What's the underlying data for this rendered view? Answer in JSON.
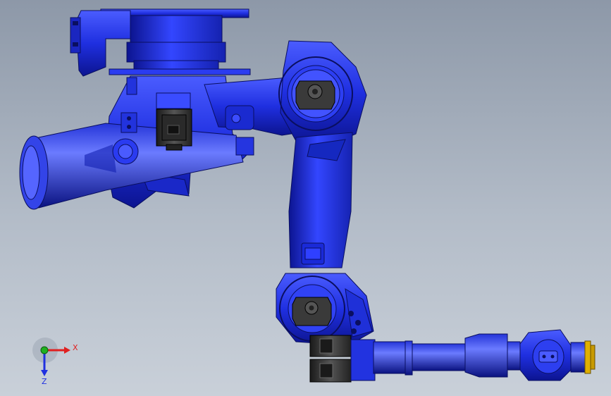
{
  "viewport": {
    "background_top": "#8d98a8",
    "background_bottom": "#c9d0d9"
  },
  "model": {
    "body_color": "#1f2fe0",
    "body_light": "#5566ff",
    "body_dark": "#0c1490",
    "motor_color": "#3a3a3a",
    "flange_color": "#e0b000"
  },
  "triad": {
    "x_label": "X",
    "z_label": "Z",
    "x_color": "#e02020",
    "y_color": "#20b020",
    "z_color": "#2030e0"
  }
}
